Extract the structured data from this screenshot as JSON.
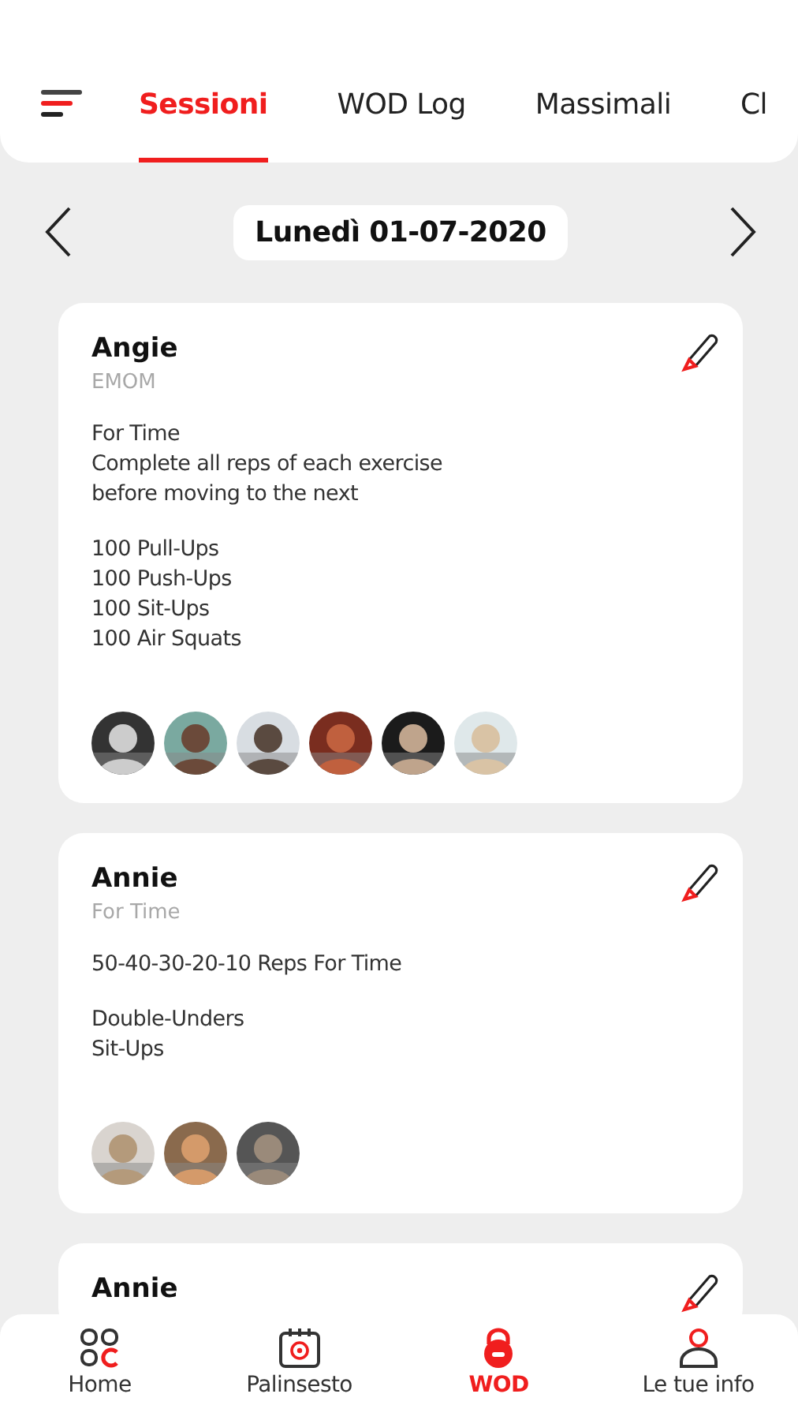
{
  "tabs": [
    {
      "label": "Sessioni",
      "selected": true
    },
    {
      "label": "WOD Log",
      "selected": false
    },
    {
      "label": "Massimali",
      "selected": false
    },
    {
      "label": "Cl",
      "selected": false
    }
  ],
  "date_bar": {
    "date": "Lunedì 01-07-2020"
  },
  "sessions": [
    {
      "title": "Angie",
      "subtitle": "EMOM",
      "paragraphs": [
        [
          "For Time",
          "Complete all reps of each exercise",
          "before moving to the next"
        ],
        [
          "100 Pull-Ups",
          "100 Push-Ups",
          "100 Sit-Ups",
          "100 Air Squats"
        ]
      ],
      "avatars": [
        {
          "kind": "picture"
        },
        {
          "kind": "picture"
        },
        {
          "kind": "picture"
        },
        {
          "kind": "picture"
        },
        {
          "kind": "picture"
        },
        {
          "kind": "picture"
        }
      ]
    },
    {
      "title": "Annie",
      "subtitle": "For Time",
      "paragraphs": [
        [
          "50-40-30-20-10 Reps For Time"
        ],
        [
          "Double-Unders",
          "Sit-Ups"
        ]
      ],
      "avatars": [
        {
          "kind": "picture"
        },
        {
          "kind": "picture"
        },
        {
          "kind": "picture"
        }
      ]
    },
    {
      "title": "Annie"
    }
  ],
  "bottom_nav": [
    {
      "label": "Home",
      "kind": "home",
      "selected": false
    },
    {
      "label": "Palinsesto",
      "kind": "calendar",
      "selected": false
    },
    {
      "label": "WOD",
      "kind": "kettlebell",
      "selected": true
    },
    {
      "label": "Le tue info",
      "kind": "profile",
      "selected": false
    }
  ]
}
